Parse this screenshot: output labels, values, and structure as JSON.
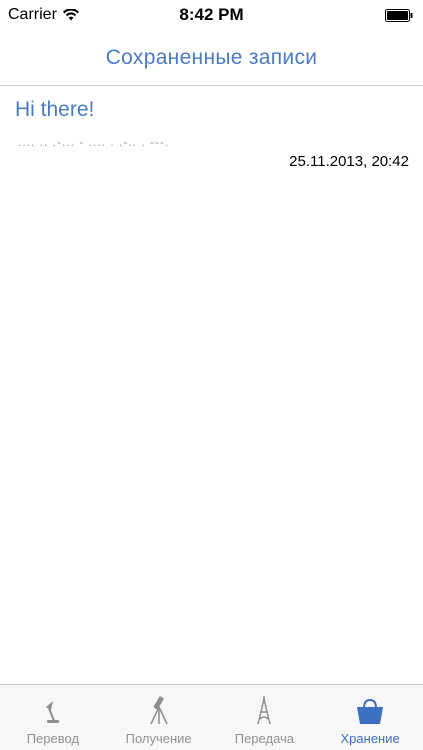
{
  "status_bar": {
    "carrier": "Carrier",
    "time": "8:42 PM"
  },
  "nav": {
    "title": "Сохраненные записи"
  },
  "records": [
    {
      "title": "Hi there!",
      "morse": ".... .. .-... - .... . .-.. . ---.",
      "date": "25.11.2013, 20:42"
    }
  ],
  "tabs": [
    {
      "label": "Перевод",
      "icon": "lamp-icon",
      "active": false
    },
    {
      "label": "Получение",
      "icon": "telescope-icon",
      "active": false
    },
    {
      "label": "Передача",
      "icon": "eiffel-tower-icon",
      "active": false
    },
    {
      "label": "Хранение",
      "icon": "bag-icon",
      "active": true
    }
  ],
  "colors": {
    "accent": "#4a7bc4",
    "inactive_tab": "#929292",
    "tab_bar_bg": "#f7f7f7"
  }
}
